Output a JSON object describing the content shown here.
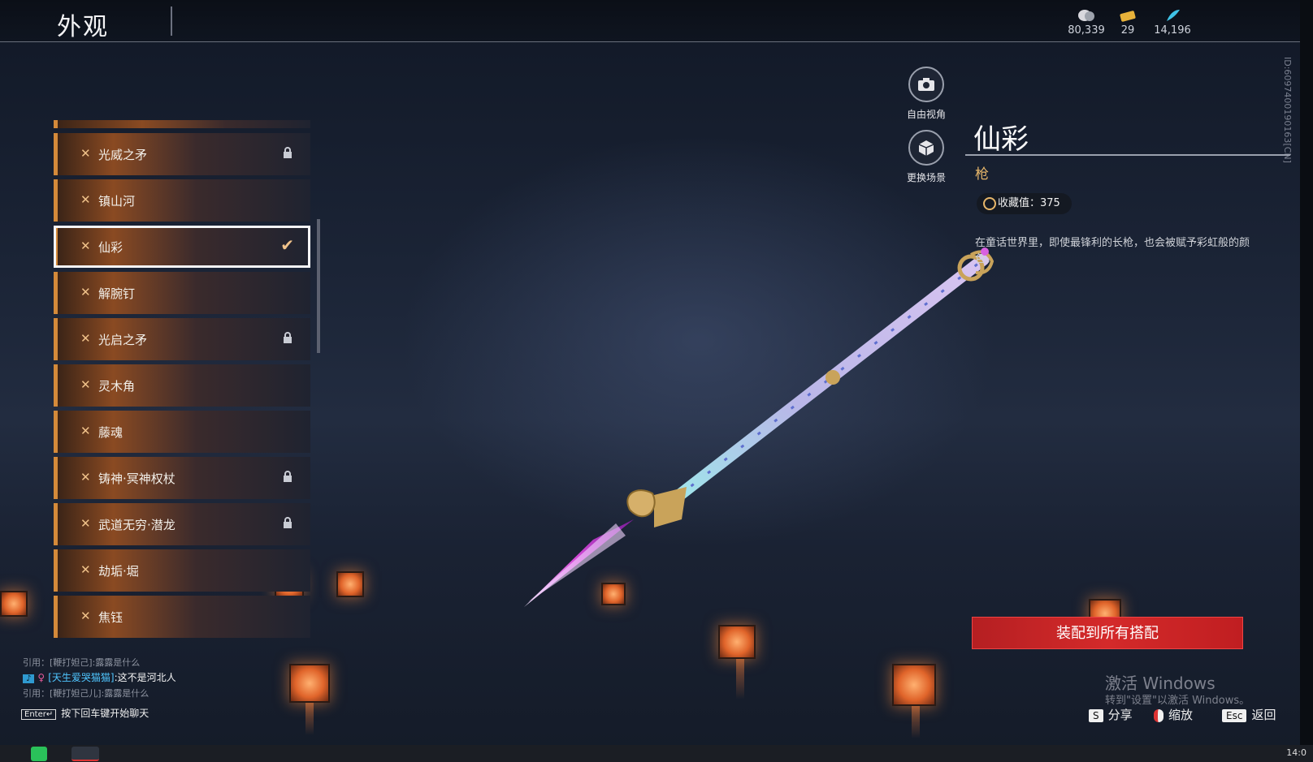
{
  "header": {
    "title": "外观",
    "currencies": [
      {
        "icon": "coin-icon",
        "value": "80,339"
      },
      {
        "icon": "ticket-icon",
        "value": "29"
      },
      {
        "icon": "feather-icon",
        "value": "14,196"
      }
    ]
  },
  "side_id": "ID:6097400190163[CN]",
  "list": {
    "items": [
      {
        "label": "光威之矛",
        "locked": true,
        "selected": false
      },
      {
        "label": "镇山河",
        "locked": false,
        "selected": false
      },
      {
        "label": "仙彩",
        "locked": false,
        "selected": true
      },
      {
        "label": "解腕钉",
        "locked": false,
        "selected": false
      },
      {
        "label": "光启之矛",
        "locked": true,
        "selected": false
      },
      {
        "label": "灵木角",
        "locked": false,
        "selected": false
      },
      {
        "label": "藤魂",
        "locked": false,
        "selected": false
      },
      {
        "label": "铸神·冥神权杖",
        "locked": true,
        "selected": false
      },
      {
        "label": "武道无穷·潜龙",
        "locked": true,
        "selected": false
      },
      {
        "label": "劫垢·堀",
        "locked": false,
        "selected": false
      },
      {
        "label": "焦钰",
        "locked": false,
        "selected": false
      }
    ]
  },
  "view_buttons": {
    "free_view": "自由视角",
    "change_scene": "更换场景"
  },
  "detail": {
    "name": "仙彩",
    "type": "枪",
    "collection_label": "收藏值：375",
    "description": "在童话世界里，即使最锋利的长枪，也会被赋予彩虹般的颜色。",
    "equip_button": "装配到所有搭配"
  },
  "watermark": {
    "line1": "激活 Windows",
    "line2": "转到\"设置\"以激活 Windows。"
  },
  "hotkeys": [
    {
      "key": "S",
      "label": "分享"
    },
    {
      "key": "",
      "label": "缩放"
    },
    {
      "key": "Esc",
      "label": "返回"
    }
  ],
  "chat": {
    "quote1": "引用：[鞭打妲己]:露露是什么",
    "msg_user": "[天生爱哭猫猫]",
    "msg_text": ":这不是河北人",
    "quote2": "引用：[鞭打妲己儿]:露露是什么",
    "enter_key": "Enter↵",
    "hint": "按下回车键开始聊天"
  },
  "taskbar": {
    "clock": "14:0"
  },
  "colors": {
    "accent_orange": "#d48a3a",
    "equip_red": "#c8222a",
    "type_gold": "#e6b66a"
  }
}
